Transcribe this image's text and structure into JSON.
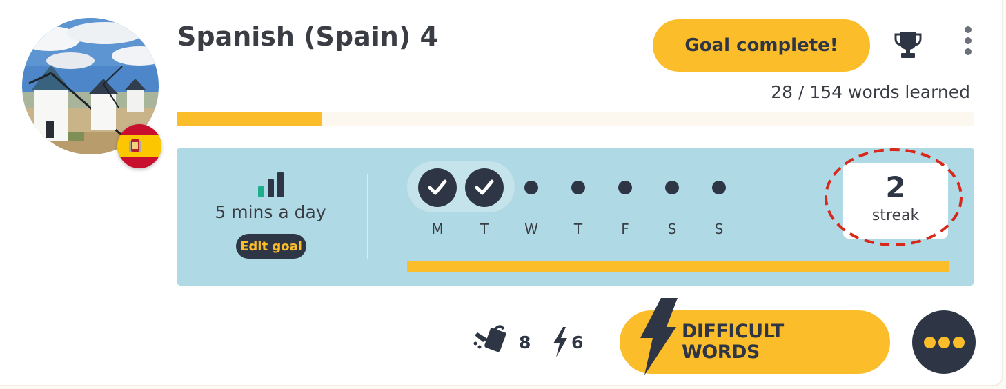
{
  "course": {
    "title": "Spanish (Spain) 4",
    "image_icon": "windmills-photo",
    "flag_icon": "spain-flag-icon"
  },
  "header": {
    "goal_button_label": "Goal complete!",
    "trophy_icon": "trophy-icon",
    "menu_icon": "kebab-menu-icon"
  },
  "progress": {
    "words_text": "28 / 154 words learned",
    "learned": 28,
    "total": 154
  },
  "goal": {
    "icon": "signal-bars-icon",
    "text": "5 mins a day",
    "edit_label": "Edit goal"
  },
  "week": {
    "days": [
      {
        "label": "M",
        "done": true
      },
      {
        "label": "T",
        "done": true
      },
      {
        "label": "W",
        "done": false
      },
      {
        "label": "T",
        "done": false
      },
      {
        "label": "F",
        "done": false
      },
      {
        "label": "S",
        "done": false
      },
      {
        "label": "S",
        "done": false
      }
    ],
    "streak_count": "2",
    "streak_label": "streak"
  },
  "stats": {
    "review_icon": "watering-can-icon",
    "review_count": "8",
    "speed_icon": "lightning-icon",
    "speed_count": "6"
  },
  "actions": {
    "difficult_line1": "DIFFICULT",
    "difficult_line2": "WORDS",
    "more_icon": "more-dots-icon"
  },
  "colors": {
    "accent": "#fbbd2a",
    "dark": "#2e3646",
    "panel": "#afd9e4",
    "text": "#3a3d44",
    "highlight_ring": "#d9271a"
  }
}
